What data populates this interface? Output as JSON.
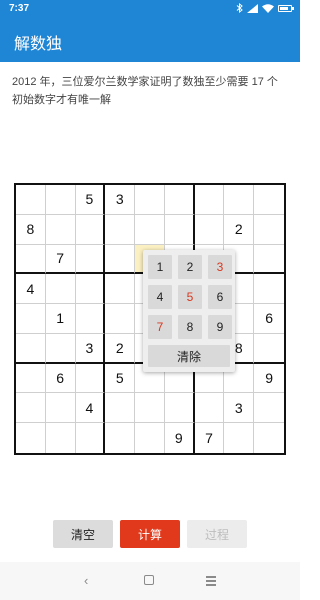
{
  "status": {
    "time": "7:37",
    "icons": [
      "bluetooth-icon",
      "signal-icon",
      "wifi-icon",
      "battery-icon"
    ]
  },
  "app": {
    "title": "解数独"
  },
  "description": "2012 年，三位爱尔兰数学家证明了数独至少需要 17 个初始数字才有唯一解",
  "grid": [
    [
      "",
      "",
      "5",
      "3",
      "",
      "",
      "",
      "",
      ""
    ],
    [
      "8",
      "",
      "",
      "",
      "",
      "",
      "",
      "2",
      ""
    ],
    [
      "",
      "7",
      "",
      "",
      "",
      "",
      "",
      "",
      ""
    ],
    [
      "4",
      "",
      "",
      "",
      "",
      "",
      "",
      "",
      ""
    ],
    [
      "",
      "1",
      "",
      "",
      "",
      "",
      "",
      "",
      "6"
    ],
    [
      "",
      "",
      "3",
      "2",
      "",
      "",
      "",
      "8",
      ""
    ],
    [
      "",
      "6",
      "",
      "5",
      "",
      "",
      "",
      "",
      "9"
    ],
    [
      "",
      "",
      "4",
      "",
      "",
      "",
      "",
      "3",
      ""
    ],
    [
      "",
      "",
      "",
      "",
      "",
      "9",
      "7",
      "",
      ""
    ]
  ],
  "selected_cell": {
    "row": 2,
    "col": 4
  },
  "picker": {
    "keys": [
      "1",
      "2",
      "3",
      "4",
      "5",
      "6",
      "7",
      "8",
      "9"
    ],
    "red_keys": [
      "3",
      "5",
      "7"
    ],
    "clear_label": "清除"
  },
  "buttons": {
    "clear": "清空",
    "calc": "计算",
    "process": "过程"
  },
  "colors": {
    "primary": "#1f86d6",
    "accent": "#e0391c",
    "highlight": "#fbf0c2"
  }
}
